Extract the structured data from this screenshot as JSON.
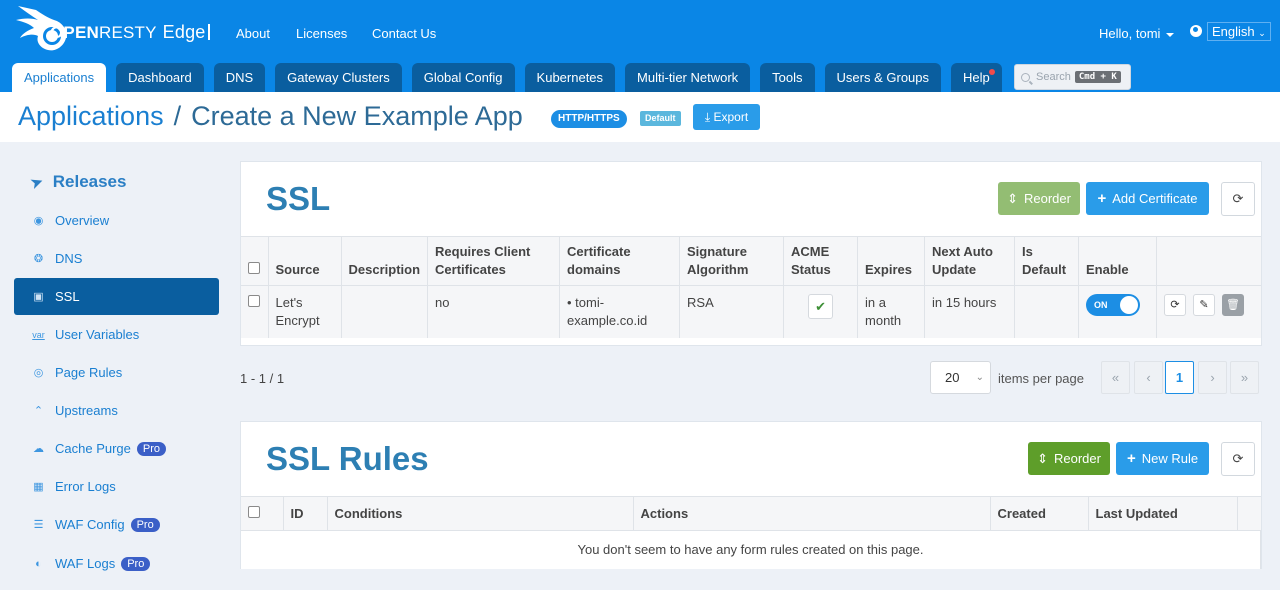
{
  "header": {
    "logo_text_bold": "OPEN",
    "logo_text_rest": "RESTY",
    "logo_product": "Edge",
    "links": [
      "About",
      "Licenses",
      "Contact Us"
    ],
    "greeting": "Hello, tomi",
    "language": "English"
  },
  "nav": {
    "tabs": [
      {
        "label": "Applications",
        "active": true
      },
      {
        "label": "Dashboard"
      },
      {
        "label": "DNS"
      },
      {
        "label": "Gateway Clusters"
      },
      {
        "label": "Global Config"
      },
      {
        "label": "Kubernetes"
      },
      {
        "label": "Multi-tier Network"
      },
      {
        "label": "Tools"
      },
      {
        "label": "Users & Groups"
      },
      {
        "label": "Help",
        "notification": true
      }
    ],
    "search_placeholder": "Search",
    "search_shortcut": "Cmd + K"
  },
  "title": {
    "root": "Applications",
    "separator": "/",
    "current": "Create a New Example App",
    "protocol_badge": "HTTP/HTTPS",
    "default_badge": "Default",
    "export_label": "Export"
  },
  "sidebar": {
    "header": "Releases",
    "items": [
      {
        "label": "Overview",
        "icon": "dashboard-icon"
      },
      {
        "label": "DNS",
        "icon": "globe-icon"
      },
      {
        "label": "SSL",
        "icon": "certificate-icon",
        "active": true
      },
      {
        "label": "User Variables",
        "icon": "var-icon"
      },
      {
        "label": "Page Rules",
        "icon": "target-icon"
      },
      {
        "label": "Upstreams",
        "icon": "chevrons-up-icon"
      },
      {
        "label": "Cache Purge",
        "icon": "cloud-icon",
        "pro": "Pro"
      },
      {
        "label": "Error Logs",
        "icon": "log-file-icon"
      },
      {
        "label": "WAF Config",
        "icon": "list-icon",
        "pro": "Pro"
      },
      {
        "label": "WAF Logs",
        "icon": "shield-log-icon",
        "pro": "Pro"
      }
    ]
  },
  "ssl": {
    "title": "SSL",
    "reorder_label": "Reorder",
    "add_label": "Add Certificate",
    "columns": [
      "Source",
      "Description",
      "Requires Client Certificates",
      "Certificate domains",
      "Signature Algorithm",
      "ACME Status",
      "Expires",
      "Next Auto Update",
      "Is Default",
      "Enable"
    ],
    "rows": [
      {
        "source": "Let's Encrypt",
        "description": "",
        "requires_client_certs": "no",
        "domains": [
          "tomi-example.co.id"
        ],
        "domain_display": "• tomi-example.co.id",
        "signature_algorithm": "RSA",
        "acme_status": "ok",
        "expires": "in a month",
        "next_auto_update": "in 15 hours",
        "is_default": "",
        "enabled": true,
        "toggle_label": "ON"
      }
    ],
    "range_text": "1 - 1 / 1",
    "per_page": "20",
    "per_page_label": "items per page",
    "current_page": "1"
  },
  "ssl_rules": {
    "title": "SSL Rules",
    "reorder_label": "Reorder",
    "new_label": "New Rule",
    "columns": [
      "ID",
      "Conditions",
      "Actions",
      "Created",
      "Last Updated"
    ],
    "empty_text": "You don't seem to have any form rules created on this page."
  }
}
